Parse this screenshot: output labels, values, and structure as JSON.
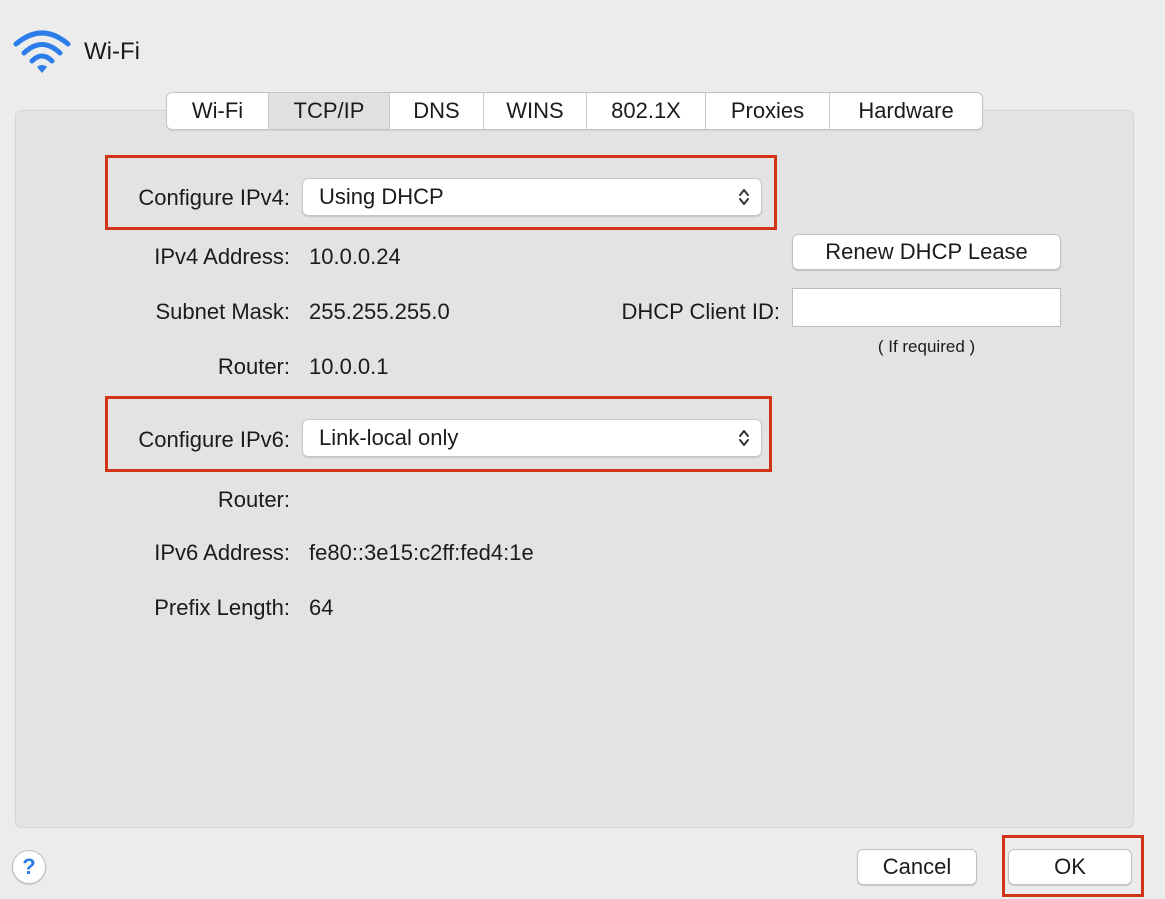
{
  "header": {
    "title": "Wi-Fi",
    "icon": "wifi-icon"
  },
  "tabs": [
    {
      "label": "Wi-Fi",
      "selected": false
    },
    {
      "label": "TCP/IP",
      "selected": true
    },
    {
      "label": "DNS",
      "selected": false
    },
    {
      "label": "WINS",
      "selected": false
    },
    {
      "label": "802.1X",
      "selected": false
    },
    {
      "label": "Proxies",
      "selected": false
    },
    {
      "label": "Hardware",
      "selected": false
    }
  ],
  "ipv4": {
    "configure_label": "Configure IPv4:",
    "configure_value": "Using DHCP",
    "address_label": "IPv4 Address:",
    "address_value": "10.0.0.24",
    "subnet_label": "Subnet Mask:",
    "subnet_value": "255.255.255.0",
    "router_label": "Router:",
    "router_value": "10.0.0.1",
    "renew_button": "Renew DHCP Lease",
    "client_id_label": "DHCP Client ID:",
    "client_id_value": "",
    "client_id_hint": "( If required )"
  },
  "ipv6": {
    "configure_label": "Configure IPv6:",
    "configure_value": "Link-local only",
    "router_label": "Router:",
    "router_value": "",
    "address_label": "IPv6 Address:",
    "address_value": "fe80::3e15:c2ff:fed4:1e",
    "prefix_label": "Prefix Length:",
    "prefix_value": "64"
  },
  "footer": {
    "help_label": "?",
    "cancel_label": "Cancel",
    "ok_label": "OK"
  },
  "colors": {
    "highlight": "#d23418",
    "accent": "#2b7de9",
    "background": "#ececec",
    "panel": "#e3e3e3"
  }
}
